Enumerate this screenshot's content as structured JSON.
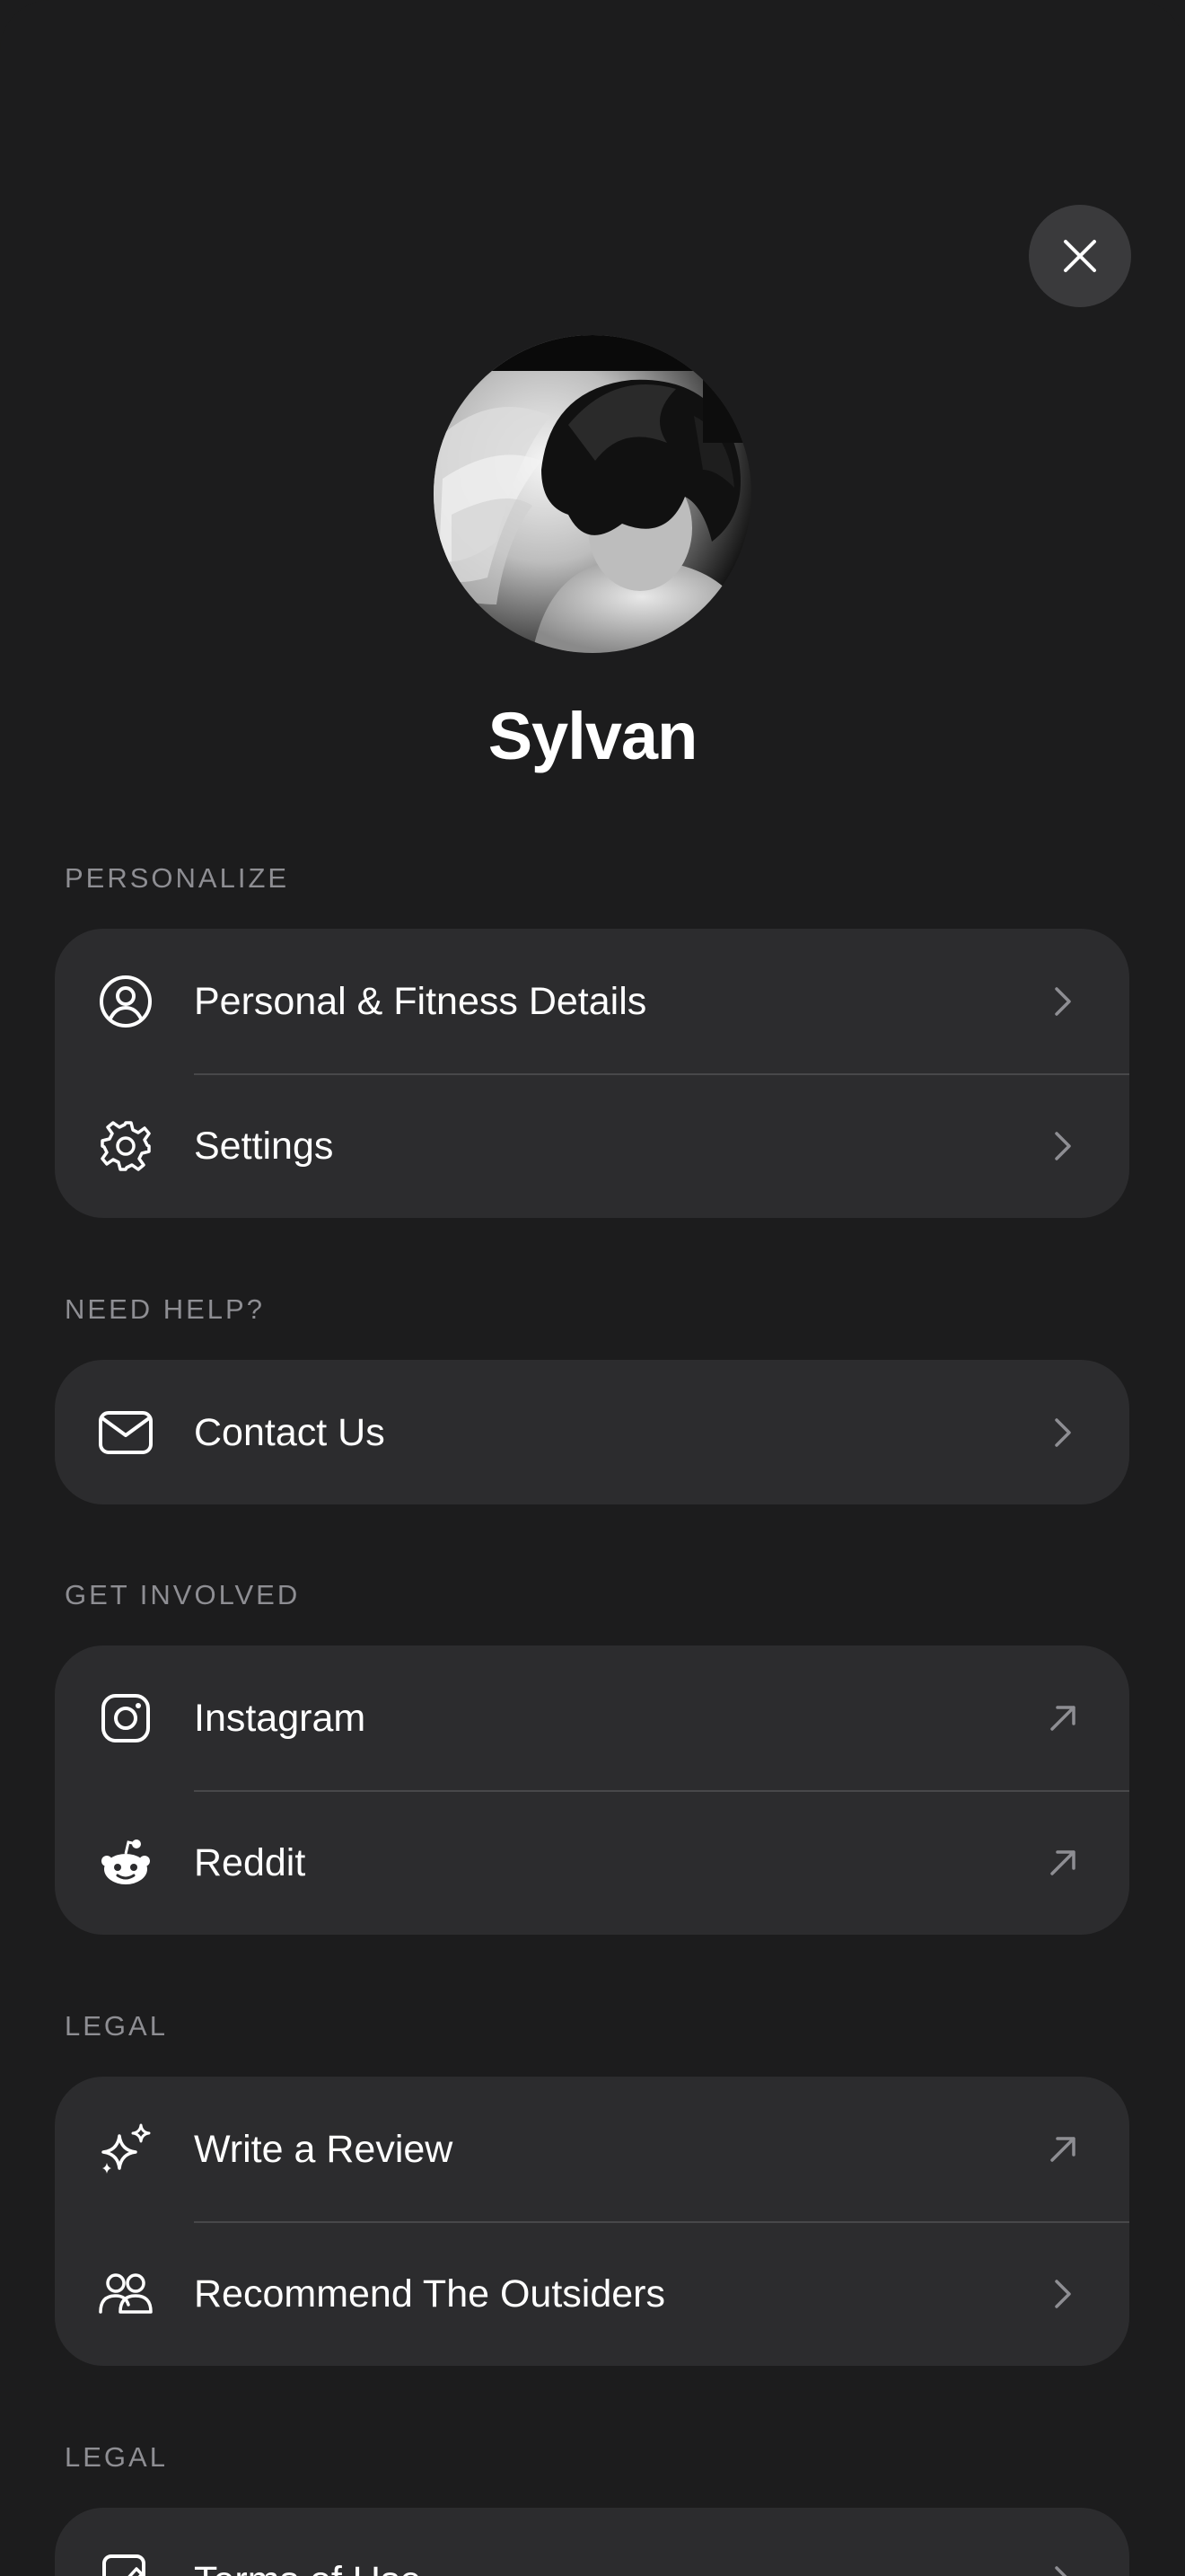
{
  "profile": {
    "name": "Sylvan"
  },
  "sections": [
    {
      "label": "PERSONALIZE",
      "items": [
        {
          "label": "Personal & Fitness Details",
          "icon": "person-circle-icon",
          "trailing": "chevron-right-icon"
        },
        {
          "label": "Settings",
          "icon": "gear-icon",
          "trailing": "chevron-right-icon"
        }
      ]
    },
    {
      "label": "NEED HELP?",
      "items": [
        {
          "label": "Contact Us",
          "icon": "envelope-icon",
          "trailing": "chevron-right-icon"
        }
      ]
    },
    {
      "label": "GET INVOLVED",
      "items": [
        {
          "label": "Instagram",
          "icon": "instagram-icon",
          "trailing": "external-arrow-icon"
        },
        {
          "label": "Reddit",
          "icon": "reddit-icon",
          "trailing": "external-arrow-icon"
        }
      ]
    },
    {
      "label": "LEGAL",
      "items": [
        {
          "label": "Write a Review",
          "icon": "sparkles-icon",
          "trailing": "external-arrow-icon"
        },
        {
          "label": "Recommend The Outsiders",
          "icon": "people-icon",
          "trailing": "chevron-right-icon"
        }
      ]
    },
    {
      "label": "LEGAL",
      "items": [
        {
          "label": "Terms of Use",
          "icon": "document-pen-icon",
          "trailing": "chevron-right-icon"
        }
      ]
    }
  ],
  "colors": {
    "background": "#1c1c1d",
    "card": "#2c2c2e",
    "section_label": "#8e8e93",
    "close_button": "#3a3a3c"
  }
}
